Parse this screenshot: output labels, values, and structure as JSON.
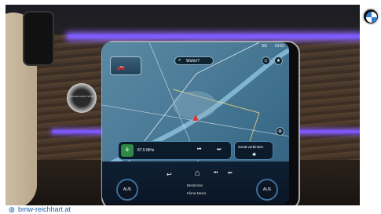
{
  "screen": {
    "status": {
      "time": "13:52",
      "signal": "5G"
    },
    "search": {
      "icon": "search-icon",
      "label": "Wohin?"
    },
    "top_icons": [
      "profile-icon",
      "star-icon"
    ],
    "media": {
      "icon": "plant-icon",
      "frequency": "87.5 MHz"
    },
    "connect": {
      "label": "Gerät verbinden",
      "icon": "bluetooth-icon"
    },
    "climate": {
      "left": "AUS",
      "right": "AUS"
    },
    "bottom_nav": {
      "back": "back-icon",
      "home": "home-icon",
      "menu1": "Bestimme",
      "menu2": "Klima-Menü"
    }
  },
  "start_button": {
    "label": "ENGINE START STOP"
  },
  "footer": {
    "url": "bmw-reichhart.at"
  },
  "colors": {
    "accent": "#1f5fa8",
    "ambient": "#7d5cff",
    "marker": "#e6333a"
  }
}
